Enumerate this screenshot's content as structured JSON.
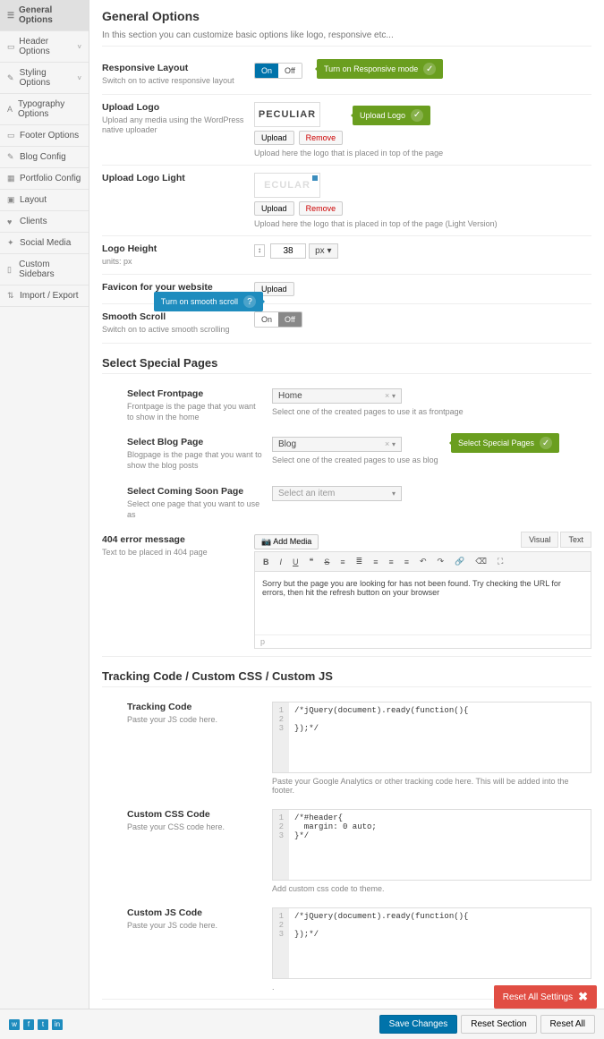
{
  "sidebar": {
    "items": [
      {
        "label": "General Options",
        "active": true
      },
      {
        "label": "Header Options",
        "expand": true
      },
      {
        "label": "Styling Options",
        "expand": true
      },
      {
        "label": "Typography Options"
      },
      {
        "label": "Footer Options"
      },
      {
        "label": "Blog Config"
      },
      {
        "label": "Portfolio Config"
      },
      {
        "label": "Layout"
      },
      {
        "label": "Clients"
      },
      {
        "label": "Social Media"
      },
      {
        "label": "Custom Sidebars"
      },
      {
        "label": "Import / Export"
      }
    ]
  },
  "page": {
    "title": "General Options",
    "intro": "In this section you can customize basic options like logo, responsive etc..."
  },
  "responsive": {
    "title": "Responsive Layout",
    "desc": "Switch on to active responsive layout",
    "on": "On",
    "off": "Off",
    "tooltip": "Turn on Responsive mode"
  },
  "logo": {
    "title": "Upload Logo",
    "desc": "Upload any media using the WordPress native uploader",
    "preview": "PECULIAR",
    "upload": "Upload",
    "remove": "Remove",
    "hint": "Upload here the logo that is placed in top of the page",
    "tooltip": "Upload Logo"
  },
  "logo_light": {
    "title": "Upload Logo Light",
    "preview": "ECULAR",
    "upload": "Upload",
    "remove": "Remove",
    "hint": "Upload here the logo that is placed in top of the page (Light Version)"
  },
  "logo_height": {
    "title": "Logo Height",
    "desc": "units: px",
    "value": "38",
    "unit": "px"
  },
  "favicon": {
    "title": "Favicon for your website",
    "upload": "Upload"
  },
  "smooth": {
    "title": "Smooth Scroll",
    "desc": "Switch on to active smooth scrolling",
    "on": "On",
    "off": "Off",
    "tooltip": "Turn on smooth scroll"
  },
  "special": {
    "heading": "Select Special Pages",
    "frontpage": {
      "title": "Select Frontpage",
      "desc": "Frontpage is the page that you want to show in the home",
      "value": "Home",
      "hint": "Select one of the created pages to use it as frontpage"
    },
    "blog": {
      "title": "Select Blog Page",
      "desc": "Blogpage is the page that you want to show the blog posts",
      "value": "Blog",
      "hint": "Select one of the created pages to use as blog",
      "tooltip": "Select Special Pages"
    },
    "coming": {
      "title": "Select Coming Soon Page",
      "desc": "Select one page that you want to use as",
      "value": "Select an item"
    },
    "err404": {
      "title": "404 error message",
      "desc": "Text to be placed in 404 page",
      "addmedia": "Add Media",
      "tabs": {
        "visual": "Visual",
        "text": "Text"
      },
      "content": "Sorry but the page you are looking for has not been found. Try checking the URL for errors, then hit the refresh button on your browser",
      "footer": "p"
    }
  },
  "code": {
    "heading": "Tracking Code / Custom CSS / Custom JS",
    "tracking": {
      "title": "Tracking Code",
      "desc": "Paste your JS code here.",
      "lines": [
        "/*jQuery(document).ready(function(){",
        "",
        "});*/"
      ],
      "hint": "Paste your Google Analytics or other tracking code here. This will be added into the footer."
    },
    "css": {
      "title": "Custom CSS Code",
      "desc": "Paste your CSS code here.",
      "lines": [
        "/*#header{",
        "  margin: 0 auto;",
        "}*/"
      ],
      "hint": "Add custom css code to theme."
    },
    "js": {
      "title": "Custom JS Code",
      "desc": "Paste your JS code here.",
      "lines": [
        "/*jQuery(document).ready(function(){",
        "",
        "});*/"
      ],
      "hint": "."
    }
  },
  "footer": {
    "reset_all": "Reset All Settings",
    "save": "Save Changes",
    "reset_section": "Reset Section",
    "reset": "Reset All"
  }
}
